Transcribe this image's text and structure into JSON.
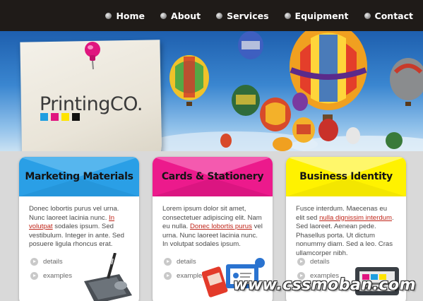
{
  "nav": {
    "items": [
      {
        "label": "Home"
      },
      {
        "label": "About"
      },
      {
        "label": "Services"
      },
      {
        "label": "Equipment"
      },
      {
        "label": "Contact"
      }
    ]
  },
  "logo": {
    "text": "PrintingCO.",
    "cmyk_colors": [
      "#1e9ee0",
      "#e0157f",
      "#ffe400",
      "#111111"
    ]
  },
  "boxes": [
    {
      "title": "Marketing Materials",
      "accent": "#2a9fe6",
      "text_before": "Donec lobortis purus vel urna. Nunc laoreet lacinia nunc. ",
      "link": "In volutpat",
      "text_after": " sodales ipsum. Sed vestibulum. Integer in ante. Sed posuere ligula rhoncus erat.",
      "details": "details",
      "examples": "examples",
      "illustration": "graphics-tablet-icon"
    },
    {
      "title": "Cards & Stationery",
      "accent": "#ec1a8c",
      "text_before": "Lorem ipsum dolor sit amet, consectetuer adipiscing elit. Nam eu nulla. ",
      "link": "Donec lobortis purus",
      "text_after": " vel urna. Nunc laoreet lacinia nunc. In volutpat sodales ipsum.",
      "details": "details",
      "examples": "examples",
      "illustration": "id-badge-icon"
    },
    {
      "title": "Business Identity",
      "accent": "#fff200",
      "text_before": "Fusce interdum. Maecenas eu elit sed ",
      "link": "nulla dignissim interdum",
      "text_after": ". Sed laoreet. Aenean pede. Phasellus porta. Ut dictum nonummy diam. Sed a leo. Cras ullamcorper nibh.",
      "details": "details",
      "examples": "examples",
      "illustration": "printer-icon"
    }
  ],
  "watermark": "www.cssmoban.com"
}
